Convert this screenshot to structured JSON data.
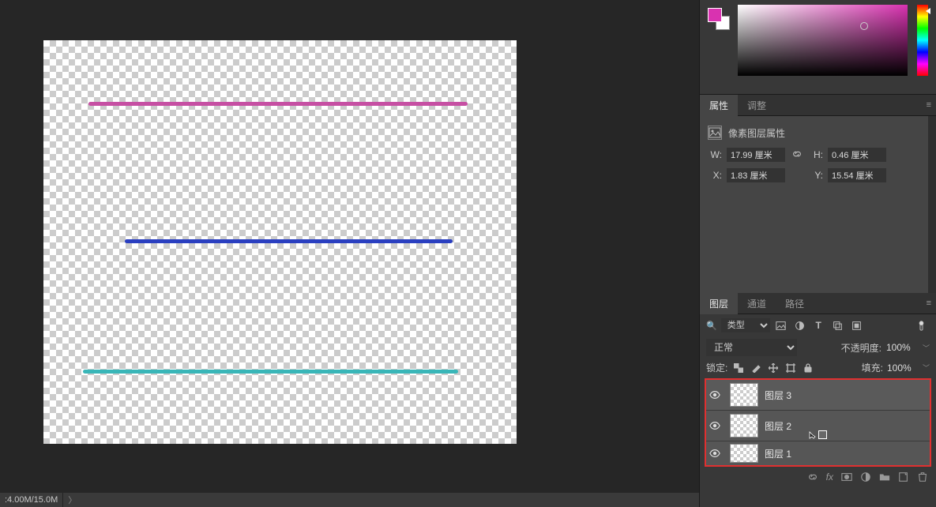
{
  "colors": {
    "foreground": "#d932b0",
    "background": "#ffffff"
  },
  "tabs_props": {
    "properties": "属性",
    "adjustments": "调整"
  },
  "properties": {
    "title": "像素图层属性",
    "w_label": "W:",
    "w_value": "17.99 厘米",
    "h_label": "H:",
    "h_value": "0.46 厘米",
    "x_label": "X:",
    "x_value": "1.83 厘米",
    "y_label": "Y:",
    "y_value": "15.54 厘米"
  },
  "tabs_layers": {
    "layers": "图层",
    "channels": "通道",
    "paths": "路径"
  },
  "layers_panel": {
    "filter_label": "类型",
    "blend_mode": "正常",
    "opacity_label": "不透明度:",
    "opacity_value": "100%",
    "lock_label": "锁定:",
    "fill_label": "填充:",
    "fill_value": "100%",
    "layers": [
      {
        "name": "图层 3"
      },
      {
        "name": "图层 2"
      },
      {
        "name": "图层 1"
      }
    ]
  },
  "statusbar": {
    "doc_size": ":4.00M/15.0M"
  }
}
